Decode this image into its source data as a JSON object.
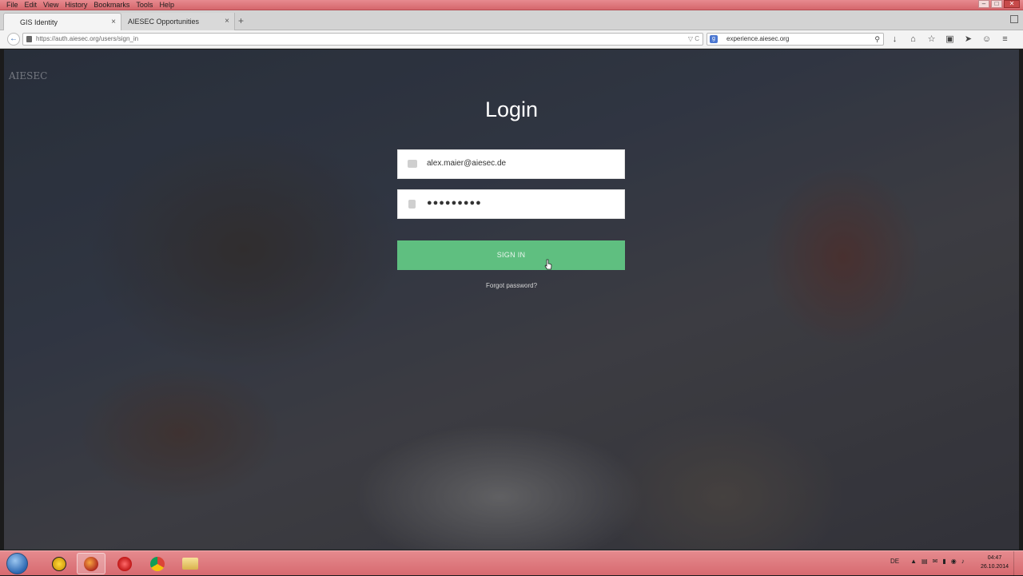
{
  "menubar": {
    "items": [
      "File",
      "Edit",
      "View",
      "History",
      "Bookmarks",
      "Tools",
      "Help"
    ]
  },
  "window_controls": {
    "minimize": "–",
    "maximize": "□",
    "close": "✕"
  },
  "tabs": [
    {
      "label": "GIS Identity",
      "active": true
    },
    {
      "label": "AIESEC Opportunities",
      "active": false
    }
  ],
  "tab_close": "×",
  "new_tab": "+",
  "navbar": {
    "back": "←",
    "url": "https://auth.aiesec.org/users/sign_in",
    "url_controls": "▽ C",
    "search_engine": "g",
    "search_value": "experience.aiesec.org",
    "search_icon": "⚲",
    "icons": [
      "↓",
      "⌂",
      "☆",
      "▣",
      "➤",
      "☺",
      "≡"
    ]
  },
  "page": {
    "watermark": "AIESEC",
    "title": "Login",
    "email_value": "alex.maier@aiesec.de",
    "password_value": "●●●●●●●●●",
    "signin_label": "SIGN IN",
    "forgot_label": "Forgot password?"
  },
  "taskbar": {
    "lang": "DE",
    "tray_icons": [
      "▲",
      "▤",
      "✉",
      "▮",
      "◉",
      "♪"
    ],
    "time": "04:47",
    "date": "26.10.2014"
  },
  "colors": {
    "signin": "#5fbf80",
    "taskbar": "#d76a70"
  }
}
